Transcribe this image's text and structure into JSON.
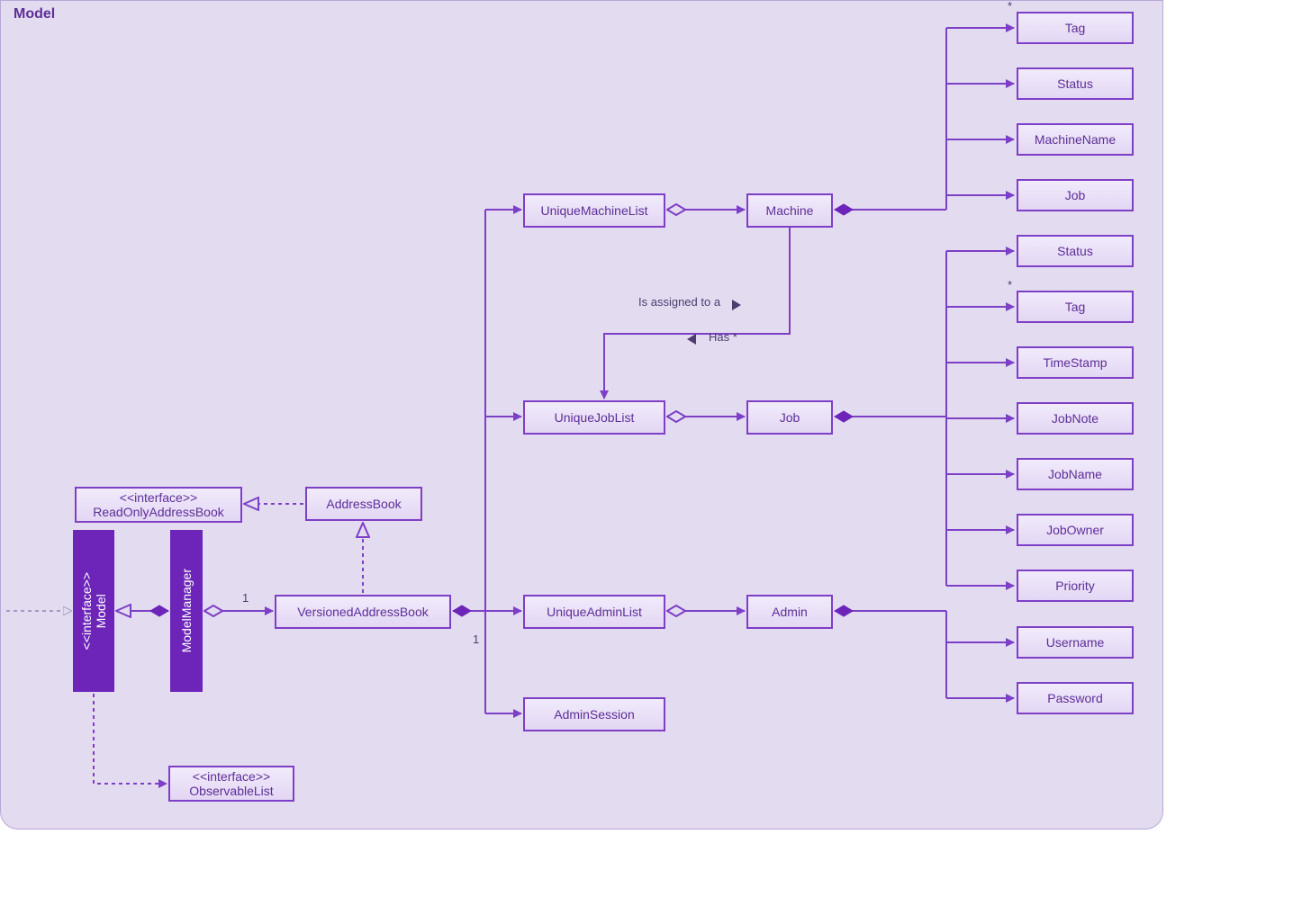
{
  "frame": {
    "title": "Model"
  },
  "nodes": {
    "modelIface": {
      "stereo": "<<interface>>",
      "name": "Model"
    },
    "modelManager": {
      "name": "ModelManager"
    },
    "roAddrBook": {
      "stereo": "<<interface>>",
      "name": "ReadOnlyAddressBook"
    },
    "addrBook": {
      "name": "AddressBook"
    },
    "versioned": {
      "name": "VersionedAddressBook"
    },
    "obsList": {
      "stereo": "<<interface>>",
      "name": "ObservableList"
    },
    "uMachine": {
      "name": "UniqueMachineList"
    },
    "uJob": {
      "name": "UniqueJobList"
    },
    "uAdmin": {
      "name": "UniqueAdminList"
    },
    "adminSession": {
      "name": "AdminSession"
    },
    "machine": {
      "name": "Machine"
    },
    "job": {
      "name": "Job"
    },
    "admin": {
      "name": "Admin"
    },
    "tag1": {
      "name": "Tag"
    },
    "status1": {
      "name": "Status"
    },
    "machineName": {
      "name": "MachineName"
    },
    "jobAttr": {
      "name": "Job"
    },
    "status2": {
      "name": "Status"
    },
    "tag2": {
      "name": "Tag"
    },
    "timeStamp": {
      "name": "TimeStamp"
    },
    "jobNote": {
      "name": "JobNote"
    },
    "jobName": {
      "name": "JobName"
    },
    "jobOwner": {
      "name": "JobOwner"
    },
    "priority": {
      "name": "Priority"
    },
    "username": {
      "name": "Username"
    },
    "password": {
      "name": "Password"
    }
  },
  "labels": {
    "assigned": "Is assigned to a",
    "has": "Has *"
  },
  "mults": {
    "mm_to_vab": "1",
    "vab_below": "1",
    "tag1": "*",
    "tag2": "*"
  },
  "colors": {
    "line": "#7e3fc7",
    "text": "#5d2e97"
  }
}
